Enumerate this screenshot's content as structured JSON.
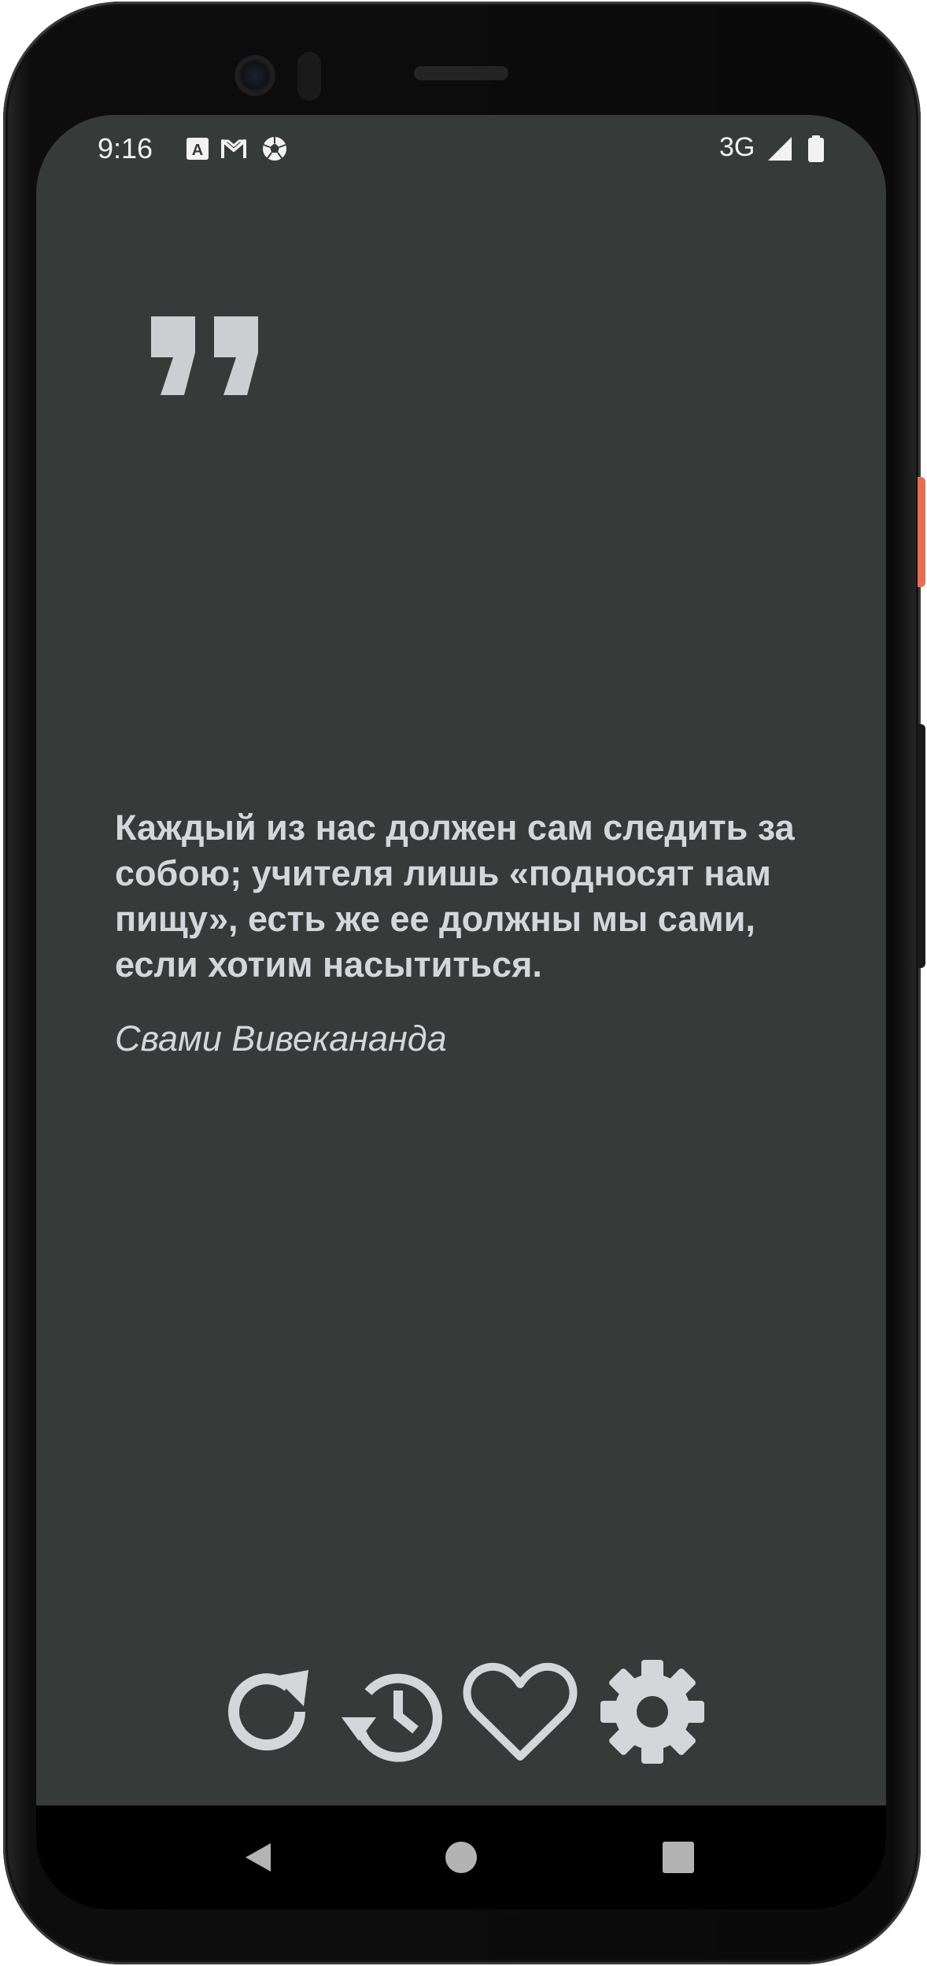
{
  "status_bar": {
    "time": "9:16",
    "notification_icons": [
      "font-a-icon",
      "gmail-icon",
      "soccer-ball-icon"
    ],
    "network": "3G",
    "status_icons": [
      "signal-icon",
      "battery-icon"
    ]
  },
  "quote": {
    "text": "Каждый из нас должен сам следить за собою; учителя лишь «подносят нам пищу», есть же ее должны мы сами, если хотим насытиться.",
    "author": "Свами Вивекананда"
  },
  "actions": [
    {
      "name": "refresh-icon"
    },
    {
      "name": "history-icon"
    },
    {
      "name": "favorite-heart-icon"
    },
    {
      "name": "settings-gear-icon"
    }
  ],
  "navigation": [
    "back-icon",
    "home-icon",
    "recents-icon"
  ],
  "colors": {
    "screen_background": "#363a39",
    "text": "#d4d6d9",
    "accent_orange": "#e86d51"
  }
}
